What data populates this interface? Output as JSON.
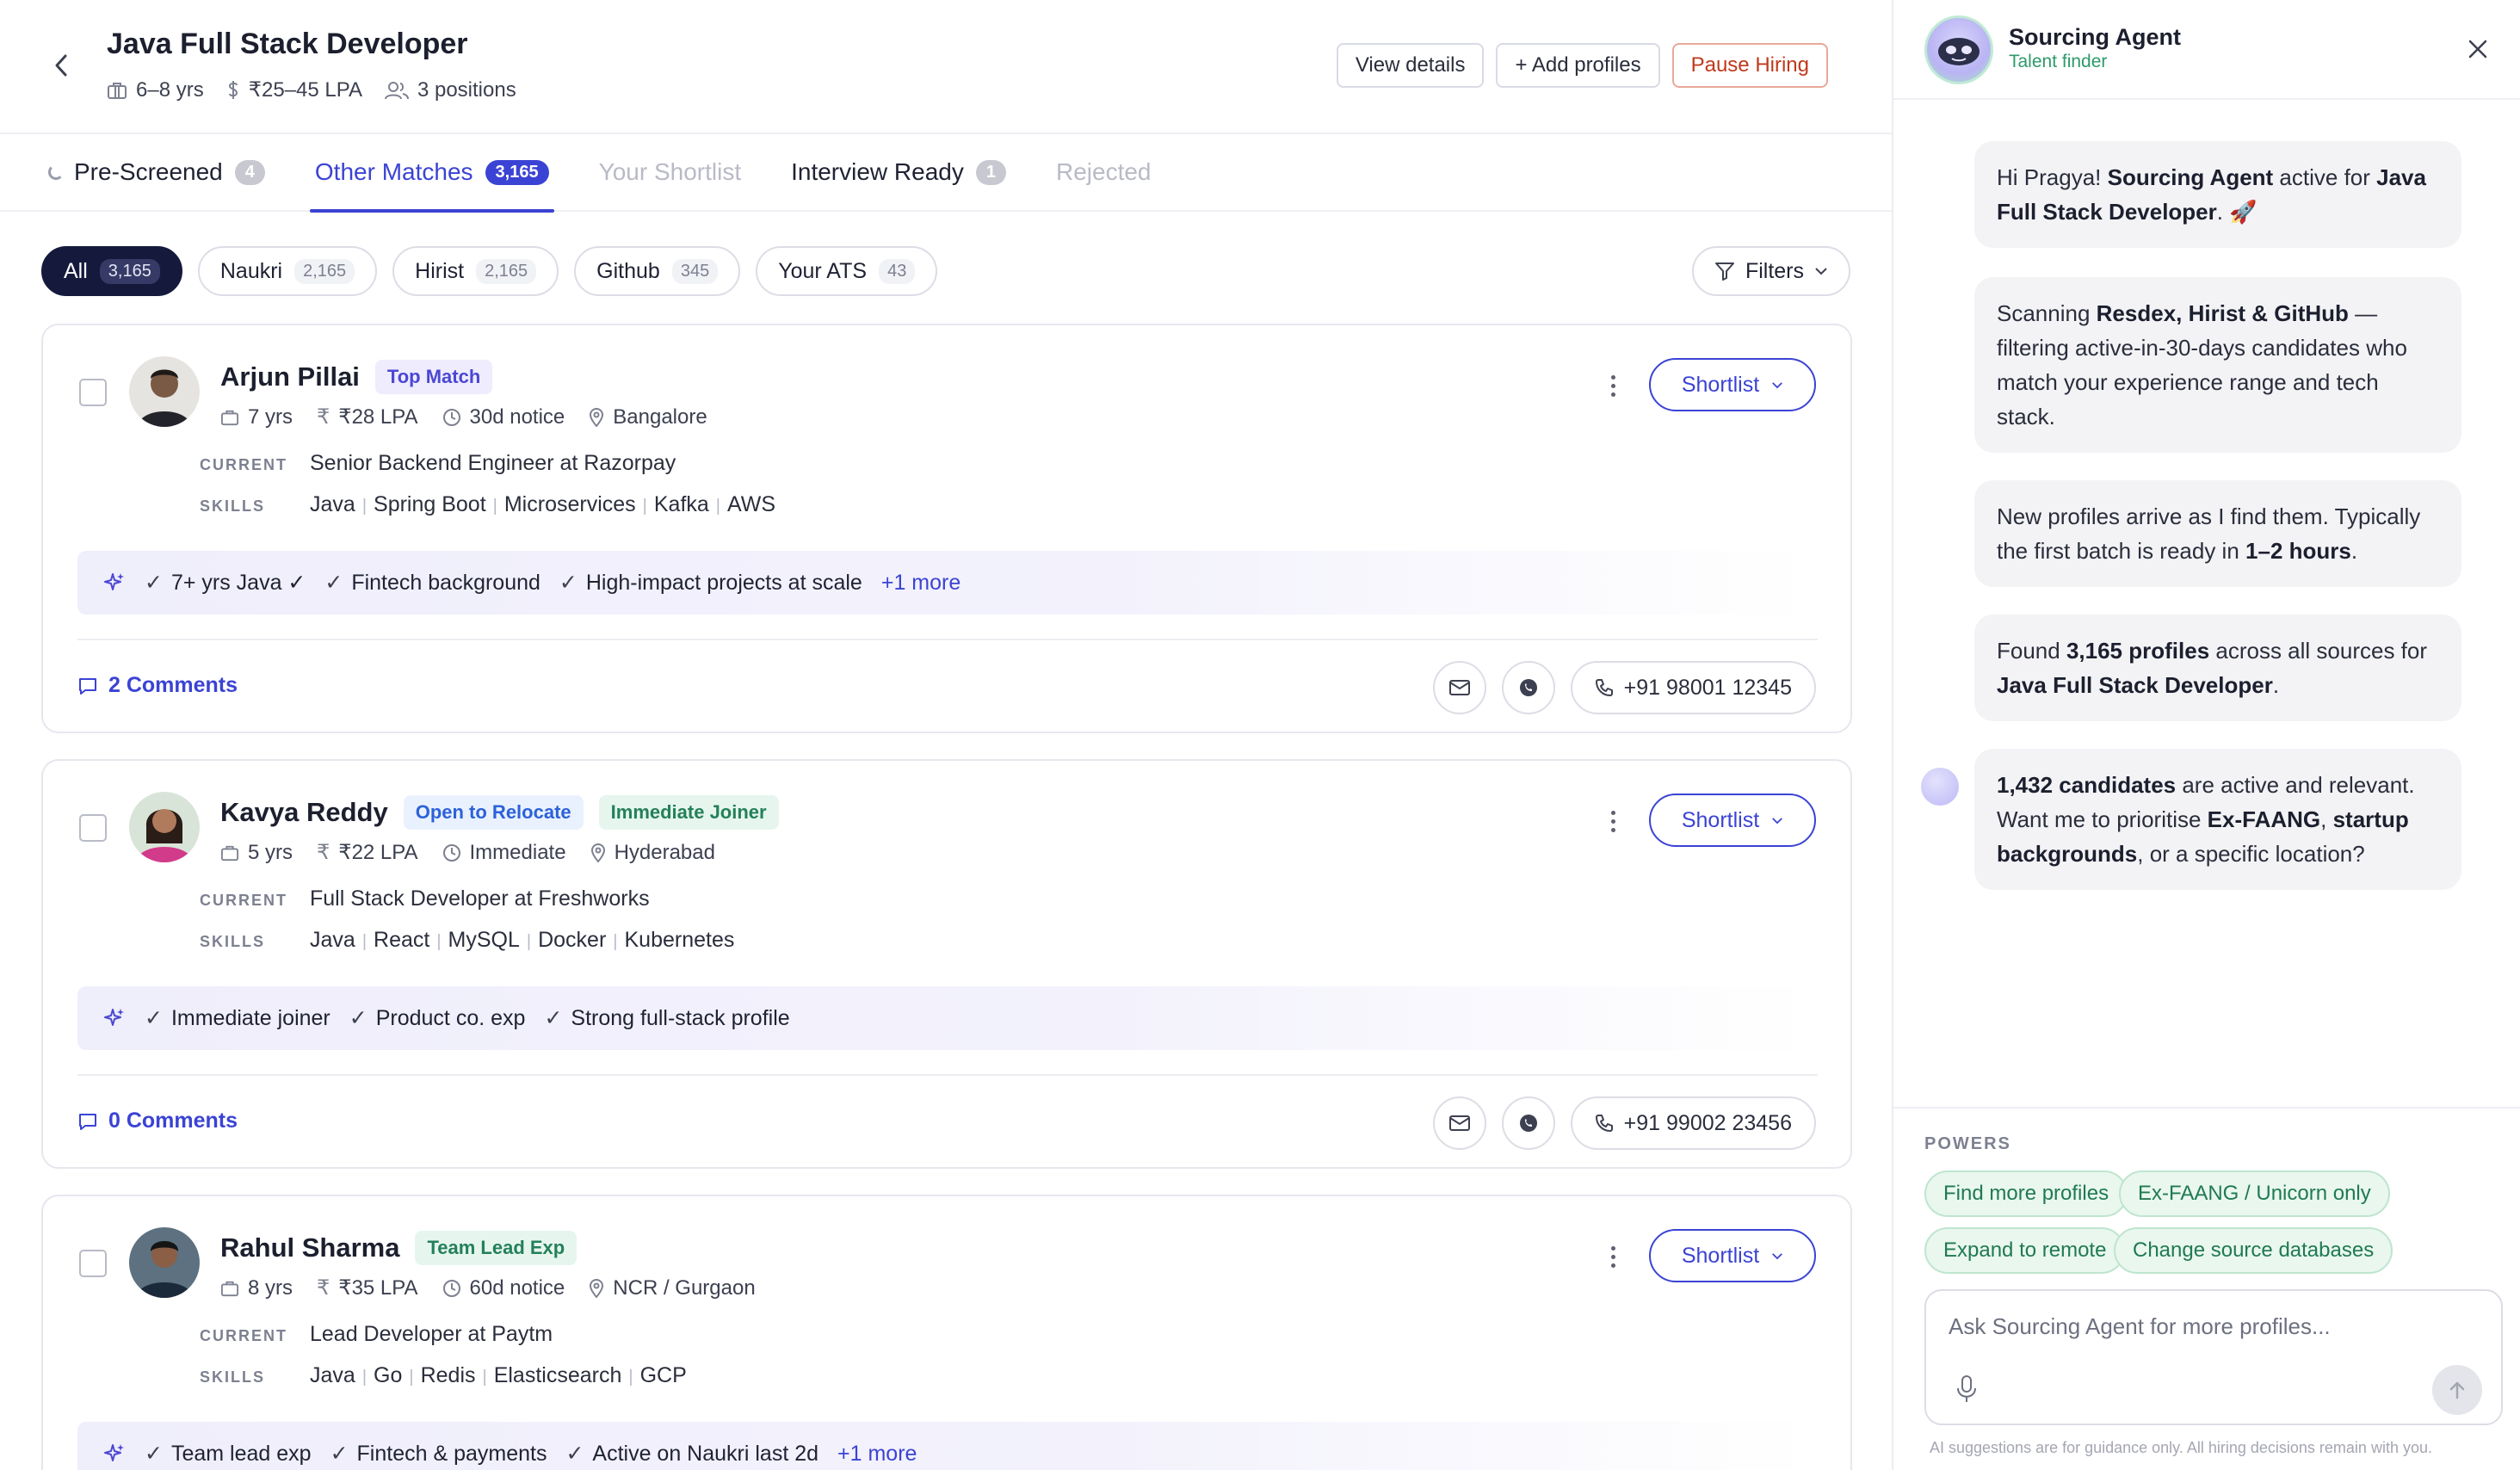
{
  "header": {
    "title": "Java Full Stack Developer",
    "experience": "6–8 yrs",
    "salary": "₹25–45 LPA",
    "positions": "3 positions",
    "view_details": "View details",
    "add_profiles": "+ Add profiles",
    "pause_hiring": "Pause Hiring"
  },
  "tabs": [
    {
      "label": "Pre-Screened",
      "count": "4"
    },
    {
      "label": "Other Matches",
      "count": "3,165"
    },
    {
      "label": "Your Shortlist",
      "count": ""
    },
    {
      "label": "Interview Ready",
      "count": "1"
    },
    {
      "label": "Rejected",
      "count": ""
    }
  ],
  "sources": [
    {
      "label": "All",
      "count": "3,165"
    },
    {
      "label": "Naukri",
      "count": "2,165"
    },
    {
      "label": "Hirist",
      "count": "2,165"
    },
    {
      "label": "Github",
      "count": "345"
    },
    {
      "label": "Your ATS",
      "count": "43"
    }
  ],
  "filters_label": "Filters",
  "labels": {
    "current": "CURRENT",
    "skills": "SKILLS",
    "shortlist": "Shortlist"
  },
  "candidates": [
    {
      "name": "Arjun Pillai",
      "badges": [
        "Top Match"
      ],
      "exp": "7 yrs",
      "ctc": "₹28 LPA",
      "notice": "30d notice",
      "location": "Bangalore",
      "current": "Senior Backend Engineer at Razorpay",
      "skills": [
        "Java",
        "Spring Boot",
        "Microservices",
        "Kafka",
        "AWS"
      ],
      "insights": [
        "7+ yrs Java ✓",
        "Fintech background",
        "High-impact projects at scale"
      ],
      "more": "+1 more",
      "comments": "2 Comments",
      "phone": "+91 98001 12345"
    },
    {
      "name": "Kavya Reddy",
      "badges": [
        "Open to Relocate",
        "Immediate Joiner"
      ],
      "exp": "5 yrs",
      "ctc": "₹22 LPA",
      "notice": "Immediate",
      "location": "Hyderabad",
      "current": "Full Stack Developer at Freshworks",
      "skills": [
        "Java",
        "React",
        "MySQL",
        "Docker",
        "Kubernetes"
      ],
      "insights": [
        "Immediate joiner",
        "Product co. exp",
        "Strong full-stack profile"
      ],
      "more": "",
      "comments": "0 Comments",
      "phone": "+91 99002 23456"
    },
    {
      "name": "Rahul Sharma",
      "badges": [
        "Team Lead Exp"
      ],
      "exp": "8 yrs",
      "ctc": "₹35 LPA",
      "notice": "60d notice",
      "location": "NCR / Gurgaon",
      "current": "Lead Developer at Paytm",
      "skills": [
        "Java",
        "Go",
        "Redis",
        "Elasticsearch",
        "GCP"
      ],
      "insights": [
        "Team lead exp",
        "Fintech & payments",
        "Active on Naukri last 2d"
      ],
      "more": "+1 more",
      "comments": "",
      "phone": ""
    }
  ],
  "agent": {
    "name": "Sourcing Agent",
    "subtitle": "Talent finder",
    "messages": {
      "m1": {
        "a": "Hi Pragya! ",
        "b": "Sourcing Agent",
        "c": " active for ",
        "d": "Java Full Stack Developer",
        "e": ". 🚀"
      },
      "m2": {
        "a": "Scanning ",
        "b": "Resdex, Hirist & GitHub",
        "c": " — filtering active-in-30-days candidates who match your experience range and tech stack."
      },
      "m3": {
        "a": "New profiles arrive as I find them. Typically the first batch is ready in ",
        "b": "1–2 hours",
        "c": "."
      },
      "m4": {
        "a": "Found ",
        "b": "3,165 profiles",
        "c": " across all sources for ",
        "d": "Java Full Stack Developer",
        "e": "."
      },
      "m5": {
        "a": "1,432 candidates",
        "b": " are active and relevant. Want me to prioritise ",
        "c": "Ex-FAANG",
        "d": ", ",
        "e": "startup backgrounds",
        "f": ", or a specific location?"
      }
    },
    "powers_label": "POWERS",
    "powers": [
      "Find more profiles",
      "Ex-FAANG / Unicorn only",
      "Expand to remote",
      "Change source databases"
    ],
    "input_placeholder": "Ask Sourcing Agent for more profiles...",
    "disclaimer": "AI suggestions are for guidance only. All hiring decisions remain with you."
  },
  "colors": {
    "accent": "#3b43d4",
    "danger": "#c0391b",
    "success": "#207a50"
  }
}
